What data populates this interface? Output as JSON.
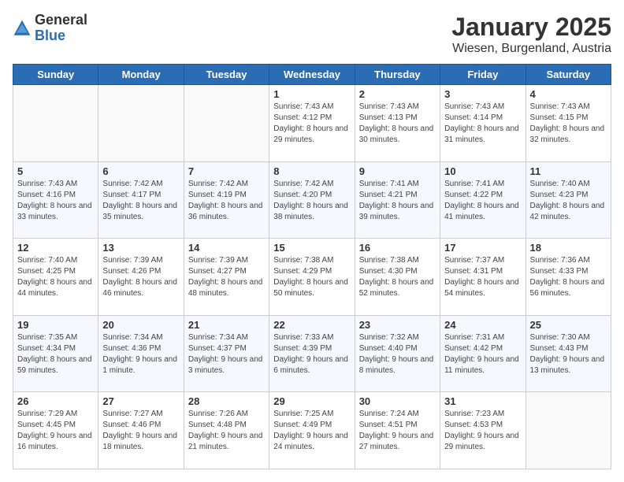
{
  "header": {
    "logo_general": "General",
    "logo_blue": "Blue",
    "month_title": "January 2025",
    "location": "Wiesen, Burgenland, Austria"
  },
  "days_of_week": [
    "Sunday",
    "Monday",
    "Tuesday",
    "Wednesday",
    "Thursday",
    "Friday",
    "Saturday"
  ],
  "weeks": [
    [
      {
        "day": "",
        "info": ""
      },
      {
        "day": "",
        "info": ""
      },
      {
        "day": "",
        "info": ""
      },
      {
        "day": "1",
        "info": "Sunrise: 7:43 AM\nSunset: 4:12 PM\nDaylight: 8 hours and 29 minutes."
      },
      {
        "day": "2",
        "info": "Sunrise: 7:43 AM\nSunset: 4:13 PM\nDaylight: 8 hours and 30 minutes."
      },
      {
        "day": "3",
        "info": "Sunrise: 7:43 AM\nSunset: 4:14 PM\nDaylight: 8 hours and 31 minutes."
      },
      {
        "day": "4",
        "info": "Sunrise: 7:43 AM\nSunset: 4:15 PM\nDaylight: 8 hours and 32 minutes."
      }
    ],
    [
      {
        "day": "5",
        "info": "Sunrise: 7:43 AM\nSunset: 4:16 PM\nDaylight: 8 hours and 33 minutes."
      },
      {
        "day": "6",
        "info": "Sunrise: 7:42 AM\nSunset: 4:17 PM\nDaylight: 8 hours and 35 minutes."
      },
      {
        "day": "7",
        "info": "Sunrise: 7:42 AM\nSunset: 4:19 PM\nDaylight: 8 hours and 36 minutes."
      },
      {
        "day": "8",
        "info": "Sunrise: 7:42 AM\nSunset: 4:20 PM\nDaylight: 8 hours and 38 minutes."
      },
      {
        "day": "9",
        "info": "Sunrise: 7:41 AM\nSunset: 4:21 PM\nDaylight: 8 hours and 39 minutes."
      },
      {
        "day": "10",
        "info": "Sunrise: 7:41 AM\nSunset: 4:22 PM\nDaylight: 8 hours and 41 minutes."
      },
      {
        "day": "11",
        "info": "Sunrise: 7:40 AM\nSunset: 4:23 PM\nDaylight: 8 hours and 42 minutes."
      }
    ],
    [
      {
        "day": "12",
        "info": "Sunrise: 7:40 AM\nSunset: 4:25 PM\nDaylight: 8 hours and 44 minutes."
      },
      {
        "day": "13",
        "info": "Sunrise: 7:39 AM\nSunset: 4:26 PM\nDaylight: 8 hours and 46 minutes."
      },
      {
        "day": "14",
        "info": "Sunrise: 7:39 AM\nSunset: 4:27 PM\nDaylight: 8 hours and 48 minutes."
      },
      {
        "day": "15",
        "info": "Sunrise: 7:38 AM\nSunset: 4:29 PM\nDaylight: 8 hours and 50 minutes."
      },
      {
        "day": "16",
        "info": "Sunrise: 7:38 AM\nSunset: 4:30 PM\nDaylight: 8 hours and 52 minutes."
      },
      {
        "day": "17",
        "info": "Sunrise: 7:37 AM\nSunset: 4:31 PM\nDaylight: 8 hours and 54 minutes."
      },
      {
        "day": "18",
        "info": "Sunrise: 7:36 AM\nSunset: 4:33 PM\nDaylight: 8 hours and 56 minutes."
      }
    ],
    [
      {
        "day": "19",
        "info": "Sunrise: 7:35 AM\nSunset: 4:34 PM\nDaylight: 8 hours and 59 minutes."
      },
      {
        "day": "20",
        "info": "Sunrise: 7:34 AM\nSunset: 4:36 PM\nDaylight: 9 hours and 1 minute."
      },
      {
        "day": "21",
        "info": "Sunrise: 7:34 AM\nSunset: 4:37 PM\nDaylight: 9 hours and 3 minutes."
      },
      {
        "day": "22",
        "info": "Sunrise: 7:33 AM\nSunset: 4:39 PM\nDaylight: 9 hours and 6 minutes."
      },
      {
        "day": "23",
        "info": "Sunrise: 7:32 AM\nSunset: 4:40 PM\nDaylight: 9 hours and 8 minutes."
      },
      {
        "day": "24",
        "info": "Sunrise: 7:31 AM\nSunset: 4:42 PM\nDaylight: 9 hours and 11 minutes."
      },
      {
        "day": "25",
        "info": "Sunrise: 7:30 AM\nSunset: 4:43 PM\nDaylight: 9 hours and 13 minutes."
      }
    ],
    [
      {
        "day": "26",
        "info": "Sunrise: 7:29 AM\nSunset: 4:45 PM\nDaylight: 9 hours and 16 minutes."
      },
      {
        "day": "27",
        "info": "Sunrise: 7:27 AM\nSunset: 4:46 PM\nDaylight: 9 hours and 18 minutes."
      },
      {
        "day": "28",
        "info": "Sunrise: 7:26 AM\nSunset: 4:48 PM\nDaylight: 9 hours and 21 minutes."
      },
      {
        "day": "29",
        "info": "Sunrise: 7:25 AM\nSunset: 4:49 PM\nDaylight: 9 hours and 24 minutes."
      },
      {
        "day": "30",
        "info": "Sunrise: 7:24 AM\nSunset: 4:51 PM\nDaylight: 9 hours and 27 minutes."
      },
      {
        "day": "31",
        "info": "Sunrise: 7:23 AM\nSunset: 4:53 PM\nDaylight: 9 hours and 29 minutes."
      },
      {
        "day": "",
        "info": ""
      }
    ]
  ]
}
